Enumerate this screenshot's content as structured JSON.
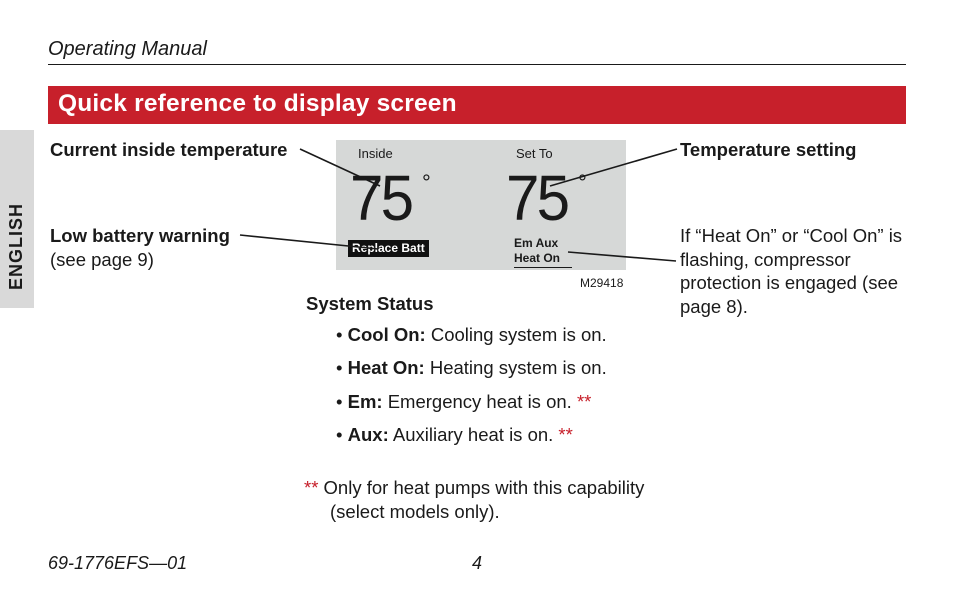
{
  "header": {
    "doc_title": "Operating Manual",
    "section_title": "Quick reference to display screen",
    "language_tab": "ENGLISH"
  },
  "lcd": {
    "inside_label": "Inside",
    "setto_label": "Set To",
    "inside_temp": "75",
    "setto_temp": "75",
    "degree": "°",
    "replace_batt": "Replace Batt",
    "status_line1": "Em  Aux",
    "status_line2": "Heat On",
    "figure_id": "M29418"
  },
  "callouts": {
    "current_inside": "Current inside temperature",
    "temp_setting": "Temperature setting",
    "low_batt_bold": "Low battery warning",
    "low_batt_sub": "(see page 9)",
    "compressor_note": "If “Heat On” or “Cool On” is flashing, compressor protection is engaged (see page 8)."
  },
  "status": {
    "heading": "System Status",
    "items": [
      {
        "label": "Cool On:",
        "desc": " Cooling system is on.",
        "star": false
      },
      {
        "label": "Heat On:",
        "desc": " Heating system is on.",
        "star": false
      },
      {
        "label": "Em:",
        "desc": " Emergency heat is on. ",
        "star": true
      },
      {
        "label": "Aux:",
        "desc": " Auxiliary heat is on. ",
        "star": true
      }
    ],
    "stars": "**",
    "footnote_lead": "** ",
    "footnote_line1": "Only for heat pumps with this capability",
    "footnote_line2": "(select models only)."
  },
  "footer": {
    "doc_number": "69-1776EFS—01",
    "page_number": "4"
  }
}
